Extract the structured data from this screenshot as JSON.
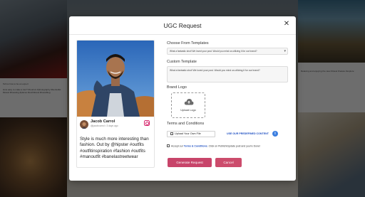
{
  "modal": {
    "title": "UGC Request",
    "close_icon": "close-icon"
  },
  "preview": {
    "author_name": "Jacob Carrol",
    "author_meta": "@jacobcarrol • 3 days ago",
    "platform_icon": "instagram-icon",
    "caption": "Style is much more interesting than fashion. Out by @hipster #outfits #outfitinspiration #fashion #outfits #manoutfit #banelastreetwear"
  },
  "templates": {
    "label": "Choose From Templates",
    "selected": "What a fantastic shot! We loved your post. Would you mind us utilizing it for our brand?"
  },
  "custom_template": {
    "label": "Custom Template",
    "value": "What a fantastic shot! We loved your post. Would you mind us utilizing it for our brand?"
  },
  "brand_logo": {
    "label": "Brand Logo",
    "upload_label": "Upload Logo",
    "icon": "cloud-upload-icon"
  },
  "terms": {
    "label": "Terms and Conditions",
    "upload_file_label": "Upload Your Own File",
    "predefined_link": "USE OUR PREDEFINED CONTENT",
    "info_icon": "info-icon",
    "accept_prefix": "Accept our",
    "accept_link": "Terms & Conditions",
    "accept_suffix": ". Click on Publish/Update post and you're Done!"
  },
  "actions": {
    "generate_label": "Generate Request",
    "cancel_label": "Cancel"
  },
  "colors": {
    "primary_button": "#c8446a",
    "link": "#1e4fc2",
    "instagram": "#d6246b"
  }
}
